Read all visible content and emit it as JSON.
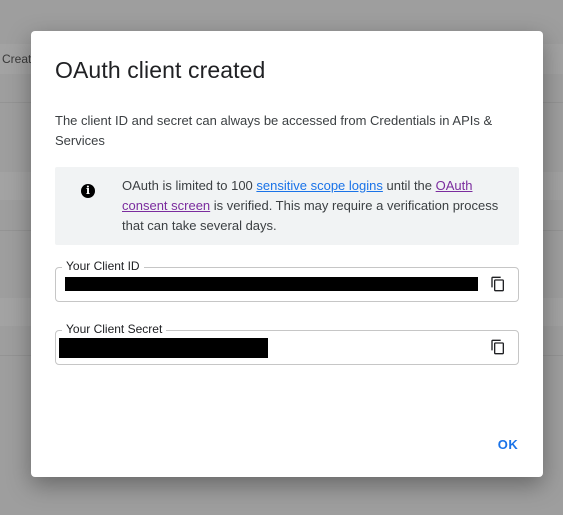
{
  "background": {
    "partial_text": "Creat"
  },
  "dialog": {
    "title": "OAuth client created",
    "description": "The client ID and secret can always be accessed from Credentials in APIs & Services",
    "notice": {
      "icon": "info-icon",
      "text_before": "OAuth is limited to 100 ",
      "link1": "sensitive scope logins",
      "text_middle": " until the ",
      "link2": "OAuth consent screen",
      "text_after": " is verified. This may require a verification process that can take several days."
    },
    "client_id": {
      "label": "Your Client ID",
      "value_redacted": true,
      "copy_icon": "copy-icon"
    },
    "client_secret": {
      "label": "Your Client Secret",
      "value_redacted": true,
      "copy_icon": "copy-icon"
    },
    "ok_label": "OK"
  },
  "colors": {
    "accent": "#1a73e8",
    "visited_link": "#7b2c9e",
    "scrim": "#9e9e9e"
  }
}
